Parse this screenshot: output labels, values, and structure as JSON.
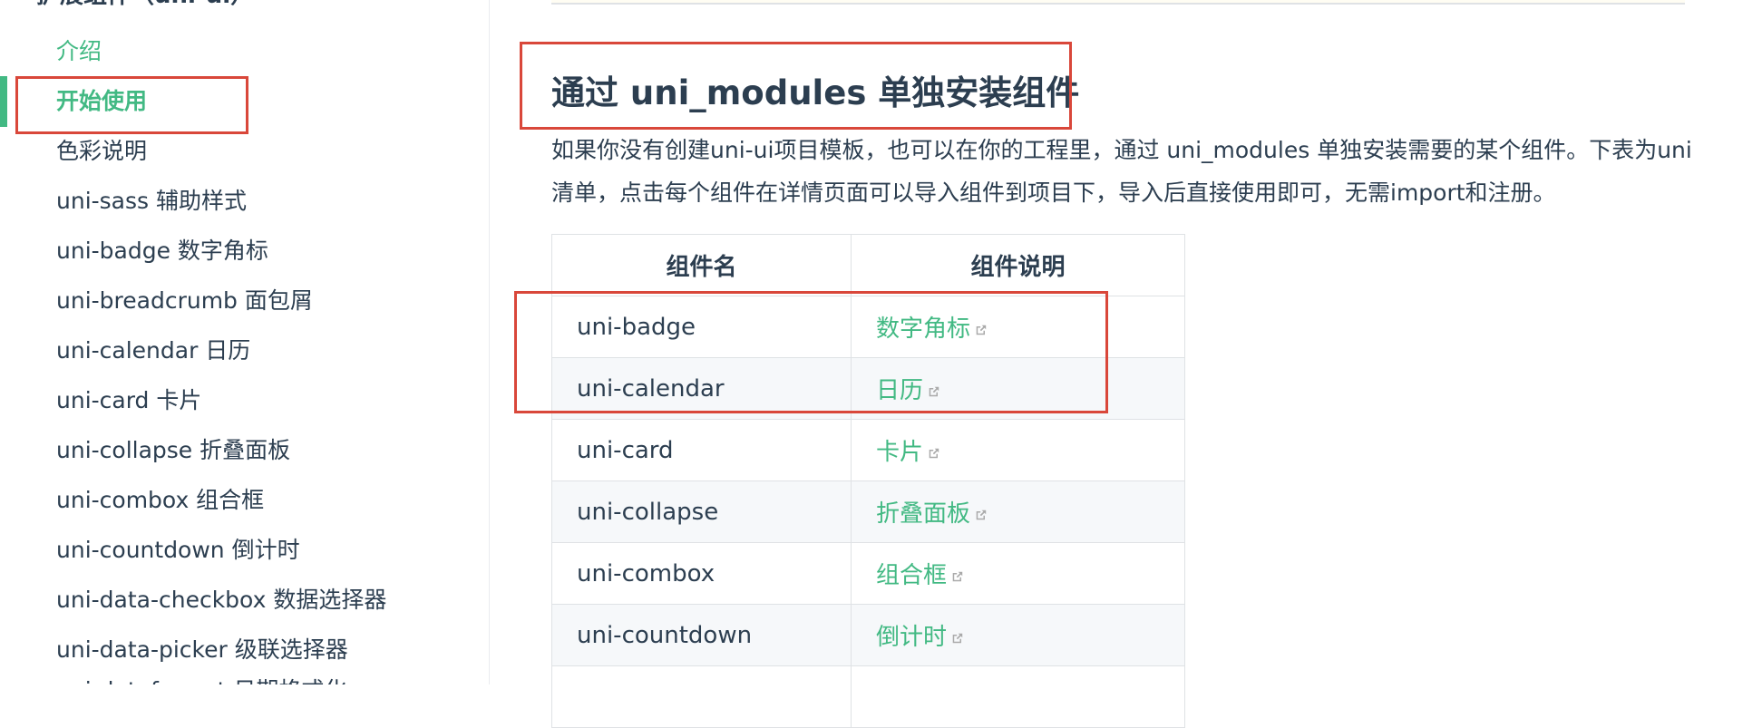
{
  "sidebar": {
    "group_title": "扩展组件（uni-ui）",
    "items": [
      {
        "label": "介绍"
      },
      {
        "label": "开始使用"
      },
      {
        "label": "色彩说明"
      },
      {
        "label": "uni-sass 辅助样式"
      },
      {
        "label": "uni-badge 数字角标"
      },
      {
        "label": "uni-breadcrumb 面包屑"
      },
      {
        "label": "uni-calendar 日历"
      },
      {
        "label": "uni-card 卡片"
      },
      {
        "label": "uni-collapse 折叠面板"
      },
      {
        "label": "uni-combox 组合框"
      },
      {
        "label": "uni-countdown 倒计时"
      },
      {
        "label": "uni-data-checkbox 数据选择器"
      },
      {
        "label": "uni-data-picker 级联选择器"
      },
      {
        "label": "uni-dateformat 日期格式化"
      }
    ]
  },
  "main": {
    "heading": "通过 uni_modules 单独安装组件",
    "paragraph_line1": "如果你没有创建uni-ui项目模板，也可以在你的工程里，通过 uni_modules 单独安装需要的某个组件。下表为uni",
    "paragraph_line2": "清单，点击每个组件在详情页面可以导入组件到项目下，导入后直接使用即可，无需import和注册。",
    "table": {
      "headers": [
        "组件名",
        "组件说明"
      ],
      "rows": [
        {
          "name": "uni-badge",
          "desc": "数字角标"
        },
        {
          "name": "uni-calendar",
          "desc": "日历"
        },
        {
          "name": "uni-card",
          "desc": "卡片"
        },
        {
          "name": "uni-collapse",
          "desc": "折叠面板"
        },
        {
          "name": "uni-combox",
          "desc": "组合框"
        },
        {
          "name": "uni-countdown",
          "desc": "倒计时"
        },
        {
          "name": "",
          "desc": ""
        }
      ]
    }
  },
  "colors": {
    "accent": "#42b983",
    "text": "#2c3e50",
    "annotation": "#d9473a"
  },
  "icons": {
    "external_link": "external-link-icon"
  }
}
